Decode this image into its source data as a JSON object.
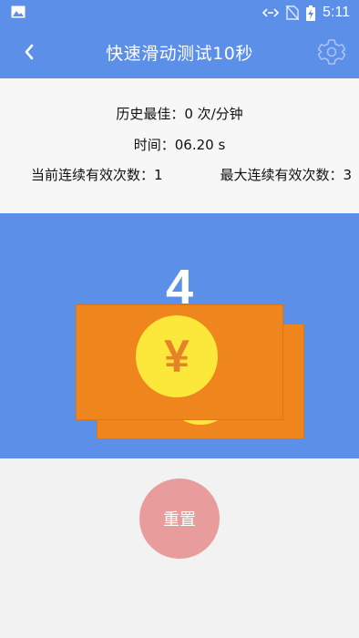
{
  "status_bar": {
    "time": "5:11"
  },
  "app_bar": {
    "title": "快速滑动测试10秒"
  },
  "stats": {
    "best": "历史最佳：0 次/分钟",
    "time": "时间：06.20 s",
    "current_streak": "当前连续有效次数：1",
    "max_streak": "最大连续有效次数：3"
  },
  "game": {
    "count": "4",
    "currency_symbol": "¥"
  },
  "actions": {
    "reset_label": "重置"
  },
  "colors": {
    "primary": "#5b8fe8",
    "bill": "#ef861d",
    "coin": "#fce83a",
    "reset": "#e99c9c"
  }
}
